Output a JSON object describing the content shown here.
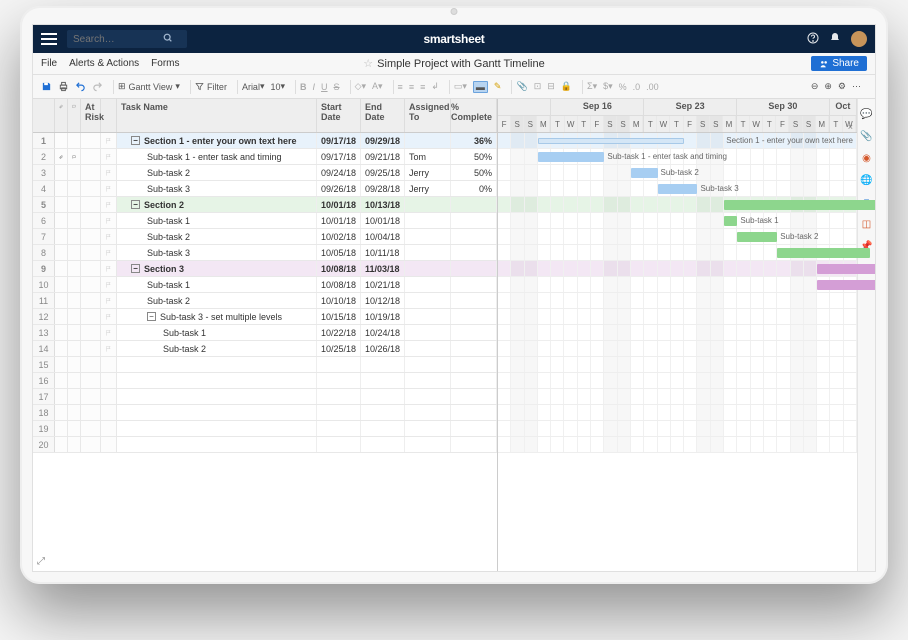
{
  "topnav": {
    "search_placeholder": "Search…",
    "brand": "smartsheet"
  },
  "menubar": {
    "file": "File",
    "alerts": "Alerts & Actions",
    "forms": "Forms",
    "title": "Simple Project with Gantt Timeline",
    "share": "Share"
  },
  "toolbar": {
    "view": "Gantt View",
    "filter": "Filter",
    "font": "Arial",
    "fontsize": "10"
  },
  "columns": {
    "risk": "At Risk",
    "name": "Task Name",
    "start": "Start Date",
    "end": "End Date",
    "assigned": "Assigned To",
    "pct": "% Complete"
  },
  "rows": [
    {
      "n": 1,
      "flag": true,
      "lvl": 0,
      "sec": true,
      "cls": "blue",
      "collapse": true,
      "name": "Section 1 - enter your own text here",
      "start": "09/17/18",
      "end": "09/29/18",
      "assigned": "",
      "pct": "36%"
    },
    {
      "n": 2,
      "clip": true,
      "chat": true,
      "flag": true,
      "lvl": 1,
      "name": "Sub-task 1 - enter task and timing",
      "start": "09/17/18",
      "end": "09/21/18",
      "assigned": "Tom",
      "pct": "50%"
    },
    {
      "n": 3,
      "flag": true,
      "lvl": 1,
      "name": "Sub-task 2",
      "start": "09/24/18",
      "end": "09/25/18",
      "assigned": "Jerry",
      "pct": "50%"
    },
    {
      "n": 4,
      "flag": true,
      "lvl": 1,
      "name": "Sub-task 3",
      "start": "09/26/18",
      "end": "09/28/18",
      "assigned": "Jerry",
      "pct": "0%"
    },
    {
      "n": 5,
      "flag": true,
      "lvl": 0,
      "sec": true,
      "cls": "green",
      "collapse": true,
      "name": "Section 2",
      "start": "10/01/18",
      "end": "10/13/18",
      "assigned": "",
      "pct": ""
    },
    {
      "n": 6,
      "flag": true,
      "lvl": 1,
      "name": "Sub-task 1",
      "start": "10/01/18",
      "end": "10/01/18",
      "assigned": "",
      "pct": ""
    },
    {
      "n": 7,
      "flag": true,
      "lvl": 1,
      "name": "Sub-task 2",
      "start": "10/02/18",
      "end": "10/04/18",
      "assigned": "",
      "pct": ""
    },
    {
      "n": 8,
      "flag": true,
      "lvl": 1,
      "name": "Sub-task 3",
      "start": "10/05/18",
      "end": "10/11/18",
      "assigned": "",
      "pct": ""
    },
    {
      "n": 9,
      "flag": true,
      "lvl": 0,
      "sec": true,
      "cls": "purple",
      "collapse": true,
      "name": "Section 3",
      "start": "10/08/18",
      "end": "11/03/18",
      "assigned": "",
      "pct": ""
    },
    {
      "n": 10,
      "flag": true,
      "lvl": 1,
      "name": "Sub-task 1",
      "start": "10/08/18",
      "end": "10/21/18",
      "assigned": "",
      "pct": ""
    },
    {
      "n": 11,
      "flag": true,
      "lvl": 1,
      "name": "Sub-task 2",
      "start": "10/10/18",
      "end": "10/12/18",
      "assigned": "",
      "pct": ""
    },
    {
      "n": 12,
      "flag": true,
      "lvl": 1,
      "collapse": true,
      "name": "Sub-task 3 - set multiple levels",
      "start": "10/15/18",
      "end": "10/19/18",
      "assigned": "",
      "pct": ""
    },
    {
      "n": 13,
      "flag": true,
      "lvl": 2,
      "name": "Sub-task 1",
      "start": "10/22/18",
      "end": "10/24/18",
      "assigned": "",
      "pct": ""
    },
    {
      "n": 14,
      "flag": true,
      "lvl": 2,
      "name": "Sub-task 2",
      "start": "10/25/18",
      "end": "10/26/18",
      "assigned": "",
      "pct": ""
    },
    {
      "n": 15
    },
    {
      "n": 16
    },
    {
      "n": 17
    },
    {
      "n": 18
    },
    {
      "n": 19
    },
    {
      "n": 20
    }
  ],
  "gantt": {
    "weeks": [
      {
        "label": "",
        "days": [
          "F",
          "S",
          "S",
          "M"
        ]
      },
      {
        "label": "Sep 16",
        "days": [
          "T",
          "W",
          "T",
          "F",
          "S",
          "S",
          "M"
        ]
      },
      {
        "label": "Sep 23",
        "days": [
          "T",
          "W",
          "T",
          "F",
          "S",
          "S",
          "M"
        ]
      },
      {
        "label": "Sep 30",
        "days": [
          "T",
          "W",
          "T",
          "F",
          "S",
          "S",
          "M"
        ]
      },
      {
        "label": "Oct",
        "days": [
          "T",
          "W"
        ]
      }
    ],
    "start": "09/14/18",
    "dayWidth": 13,
    "bars": [
      {
        "row": 0,
        "start": 3,
        "span": 11,
        "cls": "sec1",
        "label": "Section 1 - enter your own text here",
        "labelSide": "right"
      },
      {
        "row": 1,
        "start": 3,
        "span": 5,
        "cls": "blue",
        "label": "Sub-task 1 - enter task and timing"
      },
      {
        "row": 2,
        "start": 10,
        "span": 2,
        "cls": "blue",
        "label": "Sub-task 2"
      },
      {
        "row": 3,
        "start": 12,
        "span": 3,
        "cls": "blue",
        "label": "Sub-task 3"
      },
      {
        "row": 4,
        "start": 17,
        "span": 12,
        "cls": "green"
      },
      {
        "row": 5,
        "start": 17,
        "span": 1,
        "cls": "green",
        "label": "Sub-task 1"
      },
      {
        "row": 6,
        "start": 18,
        "span": 3,
        "cls": "green",
        "label": "Sub-task 2"
      },
      {
        "row": 7,
        "start": 21,
        "span": 7,
        "cls": "green"
      },
      {
        "row": 8,
        "start": 24,
        "span": 27,
        "cls": "purple"
      },
      {
        "row": 9,
        "start": 24,
        "span": 14,
        "cls": "purple"
      }
    ]
  }
}
